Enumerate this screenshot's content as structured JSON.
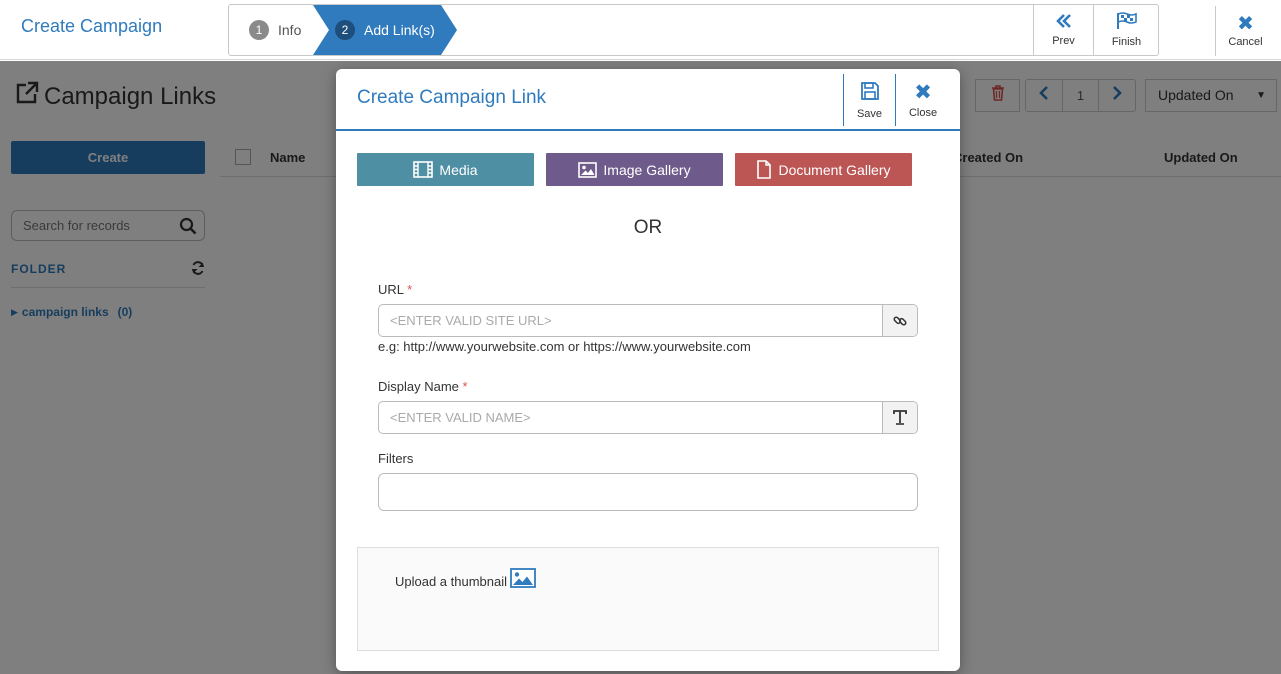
{
  "wizard": {
    "title": "Create Campaign",
    "steps": [
      {
        "num": "1",
        "label": "Info"
      },
      {
        "num": "2",
        "label": "Add Link(s)"
      }
    ],
    "prev_label": "Prev",
    "finish_label": "Finish",
    "cancel_label": "Cancel"
  },
  "page": {
    "title": "Campaign Links",
    "create_label": "Create",
    "search_placeholder": "Search for records",
    "folder_header": "FOLDER",
    "folder_item": {
      "label": "campaign links",
      "count": "(0)"
    },
    "columns": [
      "Name",
      "Created On",
      "Updated On"
    ],
    "page_number": "1",
    "sort_selected": "Updated On"
  },
  "modal": {
    "title": "Create Campaign Link",
    "save_label": "Save",
    "close_label": "Close",
    "media_label": "Media",
    "image_gallery_label": "Image Gallery",
    "document_gallery_label": "Document Gallery",
    "or_text": "OR",
    "url_label": "URL",
    "required_mark": "*",
    "url_placeholder": "<ENTER VALID SITE URL>",
    "url_hint": "e.g: http://www.yourwebsite.com or https://www.yourwebsite.com",
    "display_name_label": "Display Name",
    "display_name_placeholder": "<ENTER VALID NAME>",
    "filters_label": "Filters",
    "thumbnail_label": "Upload a thumbnail"
  },
  "colors": {
    "primary": "#2f7bbd",
    "media": "#4f8fa3",
    "image_gallery": "#6e5b8c",
    "document_gallery": "#bc5654",
    "required": "#d9534f"
  },
  "icons": [
    "external-link-icon",
    "search-icon",
    "refresh-icon",
    "double-chevron-left-icon",
    "flag-icon",
    "close-icon",
    "trash-icon",
    "chevron-left-icon",
    "chevron-right-icon",
    "save-icon",
    "film-icon",
    "image-icon",
    "document-icon",
    "link-icon",
    "text-icon"
  ]
}
